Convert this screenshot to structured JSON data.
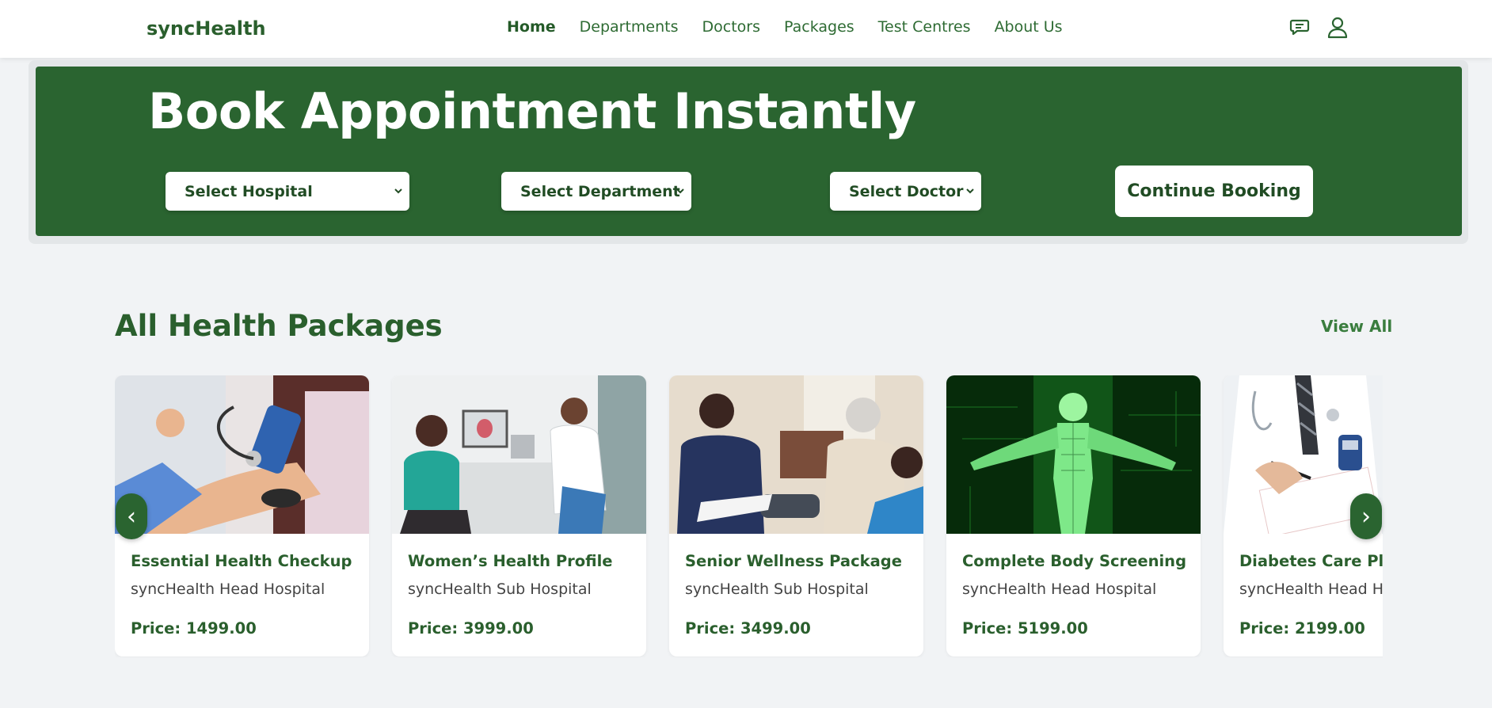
{
  "nav": {
    "brand": "syncHealth",
    "links": [
      {
        "label": "Home",
        "active": true
      },
      {
        "label": "Departments"
      },
      {
        "label": "Doctors"
      },
      {
        "label": "Packages"
      },
      {
        "label": "Test Centres"
      },
      {
        "label": "About Us"
      }
    ],
    "icons": [
      "chat-icon",
      "user-icon"
    ]
  },
  "hero": {
    "title": "Book Appointment Instantly",
    "selects": {
      "hospital": "Select Hospital",
      "department": "Select Department",
      "doctor": "Select Doctor"
    },
    "continue_label": "Continue Booking"
  },
  "packages": {
    "title": "All Health Packages",
    "view_all": "View All",
    "prev_arrow": "‹",
    "next_arrow": "›",
    "items": [
      {
        "name": "Essential Health Checkup",
        "hospital": "syncHealth Head Hospital",
        "price": "Price: 1499.00"
      },
      {
        "name": "Women’s Health Profile",
        "hospital": "syncHealth Sub Hospital",
        "price": "Price: 3999.00"
      },
      {
        "name": "Senior Wellness Package",
        "hospital": "syncHealth Sub Hospital",
        "price": "Price: 3499.00"
      },
      {
        "name": "Complete Body Screening",
        "hospital": "syncHealth Head Hospital",
        "price": "Price: 5199.00"
      },
      {
        "name": "Diabetes Care Plan",
        "hospital": "syncHealth Head Hospital",
        "price": "Price: 2199.00"
      }
    ]
  },
  "colors": {
    "primary": "#2a6430",
    "background": "#f1f3f5"
  }
}
